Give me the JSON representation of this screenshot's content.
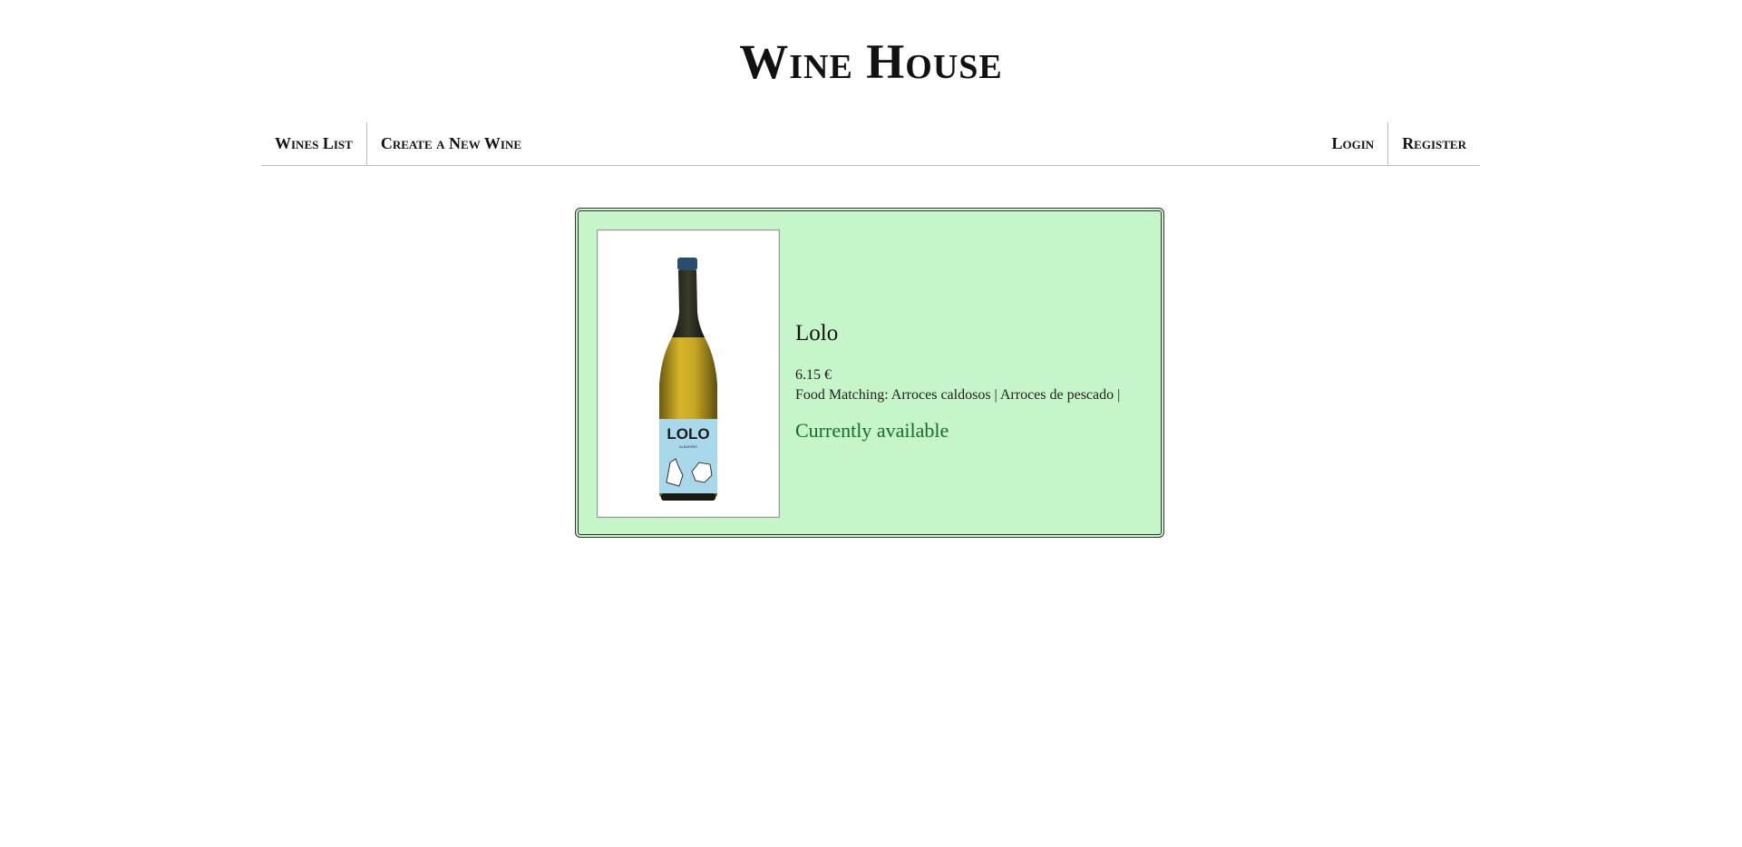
{
  "site": {
    "title": "Wine House"
  },
  "nav": {
    "left": [
      "Wines List",
      "Create a New Wine"
    ],
    "right": [
      "Login",
      "Register"
    ]
  },
  "wine": {
    "name": "Lolo",
    "price": "6.15 €",
    "food_label": "Food Matching:",
    "food_items": "Arroces caldosos | Arroces de pescado |",
    "status": "Currently available",
    "label_text": "LOLO",
    "label_subtext": "ALBARIÑO",
    "colors": {
      "card_background": "#c5f5c8",
      "status_text": "#1a6a2a",
      "bottle_wine": "#c9a825",
      "bottle_label": "#a8d8ea",
      "capsule": "#2a4d6e"
    }
  }
}
